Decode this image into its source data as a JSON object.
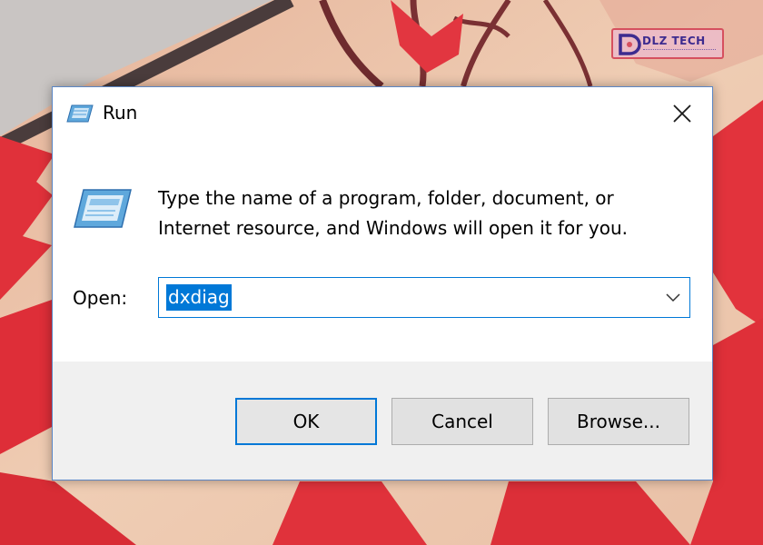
{
  "watermark": {
    "brand": "DLZ TECH"
  },
  "dialog": {
    "title": "Run",
    "icons": {
      "title": "run-app-icon",
      "body": "run-app-icon",
      "close": "close-icon",
      "dropdown": "chevron-down-icon"
    },
    "message_lines": [
      "Type the name of a program, folder, document, or",
      "Internet resource, and Windows will open it for you."
    ],
    "open_label": "Open:",
    "open_value": "dxdiag",
    "buttons": {
      "ok": "OK",
      "cancel": "Cancel",
      "browse": "Browse..."
    }
  },
  "colors": {
    "accent": "#0078d7",
    "footer": "#f0f0f0",
    "leaf": "#e0313a"
  }
}
